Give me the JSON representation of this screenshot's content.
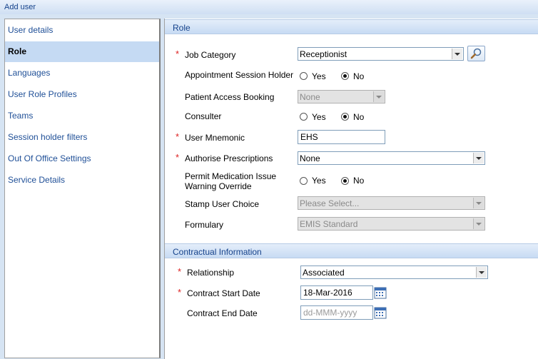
{
  "window": {
    "title": "Add user"
  },
  "sidebar": {
    "items": [
      {
        "label": "User details",
        "active": false
      },
      {
        "label": "Role",
        "active": true
      },
      {
        "label": "Languages",
        "active": false
      },
      {
        "label": "User Role Profiles",
        "active": false
      },
      {
        "label": "Teams",
        "active": false
      },
      {
        "label": "Session holder filters",
        "active": false
      },
      {
        "label": "Out Of Office Settings",
        "active": false
      },
      {
        "label": "Service Details",
        "active": false
      }
    ]
  },
  "role": {
    "header": "Role",
    "job_category": {
      "label": "Job Category",
      "value": "Receptionist",
      "required": true
    },
    "appointment_session_holder": {
      "label": "Appointment Session Holder",
      "yes": "Yes",
      "no": "No",
      "selected": "No"
    },
    "patient_access_booking": {
      "label": "Patient Access Booking",
      "value": "None",
      "disabled": true
    },
    "consulter": {
      "label": "Consulter",
      "yes": "Yes",
      "no": "No",
      "selected": "No"
    },
    "user_mnemonic": {
      "label": "User Mnemonic",
      "value": "EHS",
      "required": true
    },
    "authorise_prescriptions": {
      "label": "Authorise Prescriptions",
      "value": "None",
      "required": true
    },
    "permit_medication": {
      "label_line1": "Permit Medication Issue",
      "label_line2": "Warning Override",
      "yes": "Yes",
      "no": "No",
      "selected": "No"
    },
    "stamp_user_choice": {
      "label": "Stamp User Choice",
      "value": "Please Select...",
      "disabled": true
    },
    "formulary": {
      "label": "Formulary",
      "value": "EMIS Standard",
      "disabled": true
    }
  },
  "contractual": {
    "header": "Contractual Information",
    "relationship": {
      "label": "Relationship",
      "value": "Associated",
      "required": true
    },
    "contract_start_date": {
      "label": "Contract Start Date",
      "value": "18-Mar-2016",
      "required": true
    },
    "contract_end_date": {
      "label": "Contract End Date",
      "placeholder": "dd-MMM-yyyy"
    }
  },
  "colors": {
    "accent": "#15428b",
    "link": "#1f4f97",
    "active_bg": "#c5daf3",
    "required": "#dd2222"
  }
}
